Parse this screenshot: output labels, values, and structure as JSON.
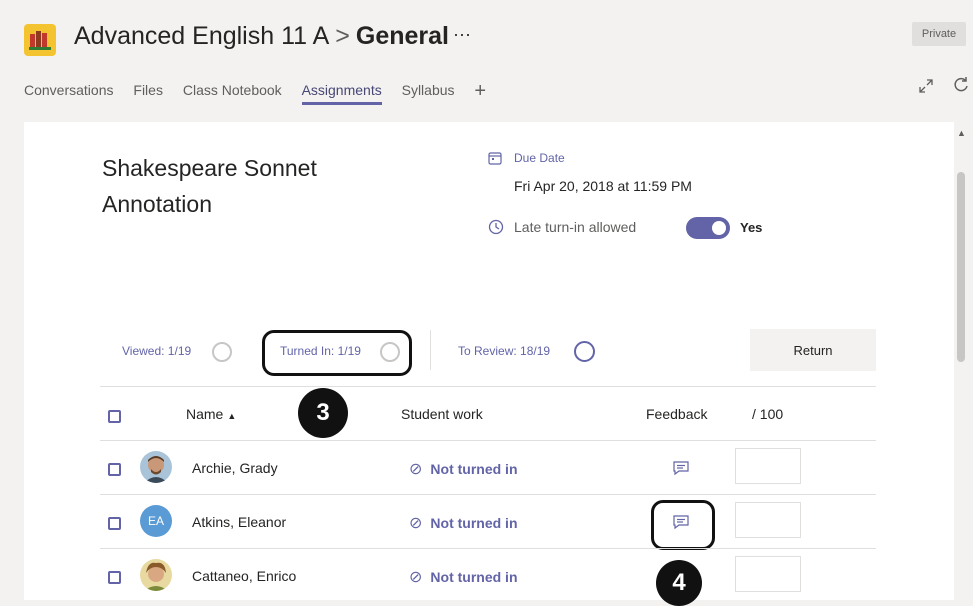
{
  "header": {
    "team_name": "Advanced English 11 A",
    "separator": ">",
    "channel_name": "General",
    "more": "···",
    "privacy_badge": "Private"
  },
  "tabs": [
    {
      "label": "Conversations",
      "active": false
    },
    {
      "label": "Files",
      "active": false
    },
    {
      "label": "Class Notebook",
      "active": false
    },
    {
      "label": "Assignments",
      "active": true
    },
    {
      "label": "Syllabus",
      "active": false
    }
  ],
  "tab_add": "+",
  "assignment": {
    "title": "Shakespeare Sonnet Annotation",
    "due_label": "Due Date",
    "due_value": "Fri Apr 20, 2018 at 11:59 PM",
    "late_label": "Late turn-in allowed",
    "late_value": "Yes",
    "late_enabled": true
  },
  "stats": {
    "viewed": "Viewed: 1/19",
    "turned_in": "Turned In: 1/19",
    "to_review": "To Review: 18/19",
    "return_label": "Return"
  },
  "table": {
    "columns": {
      "name": "Name",
      "sort_indicator": "▲",
      "student_work": "Student work",
      "feedback": "Feedback",
      "score": "/ 100"
    },
    "rows": [
      {
        "name": "Archie, Grady",
        "status": "Not turned in",
        "avatar": "photo",
        "score": ""
      },
      {
        "name": "Atkins, Eleanor",
        "status": "Not turned in",
        "avatar": "EA",
        "score": ""
      },
      {
        "name": "Cattaneo, Enrico",
        "status": "Not turned in",
        "avatar": "photo",
        "score": ""
      }
    ]
  },
  "callouts": {
    "first": "3",
    "second": "4"
  },
  "colors": {
    "accent": "#6264a7",
    "background": "#f3f2f1",
    "card": "#ffffff"
  },
  "icons": {
    "app": "team-app-icon",
    "status": "blocked-circle-icon",
    "feedback": "comment-icon",
    "due": "calendar-icon",
    "late": "clock-icon"
  }
}
